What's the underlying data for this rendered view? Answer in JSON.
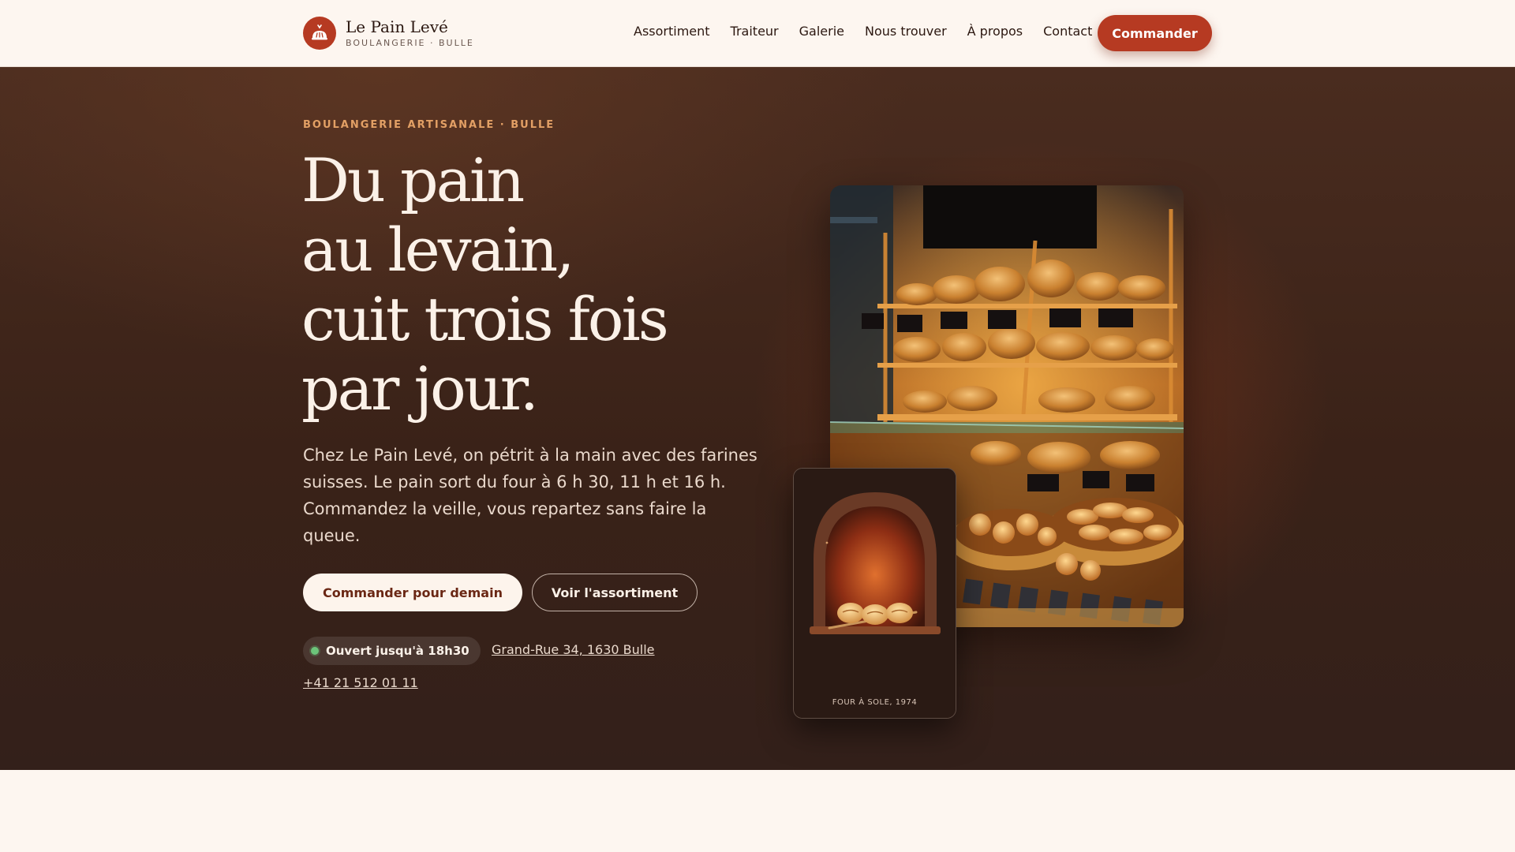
{
  "brand": {
    "name": "Le Pain Levé",
    "tagline": "BOULANGERIE · BULLE",
    "accent": "#b63a22",
    "logo_icon": "bread-basket-icon"
  },
  "nav": {
    "items": [
      "Assortiment",
      "Traiteur",
      "Galerie",
      "Nous trouver",
      "À propos",
      "Contact"
    ],
    "cta_label": "Commander"
  },
  "hero": {
    "eyebrow": "BOULANGERIE ARTISANALE · BULLE",
    "headline_lines": [
      "Du pain",
      "au levain,",
      "cuit trois fois",
      "par jour."
    ],
    "lede": "Chez Le Pain Levé, on pétrit à la main avec des farines suisses. Le pain sort du four à 6 h 30, 11 h et 16 h. Commandez la veille, vous repartez sans faire la queue.",
    "primary_cta": "Commander pour demain",
    "secondary_cta": "Voir l'assortiment",
    "status": "Ouvert jusqu'à 18h30",
    "status_color": "#6cc47a",
    "address": "Grand-Rue 34, 1630 Bulle",
    "phone": "+41 21 512 01 11"
  },
  "media": {
    "photo_alt": "bakery display shelves with breads and pastries",
    "oven_caption": "FOUR À SOLE, 1974"
  }
}
